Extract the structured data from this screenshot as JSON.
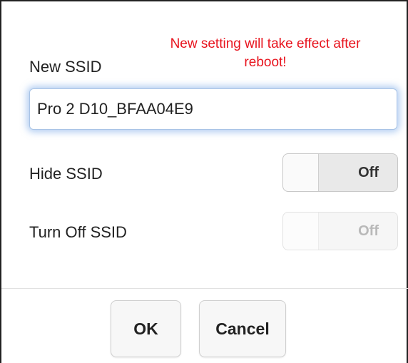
{
  "form": {
    "new_ssid_label": "New SSID",
    "warning_line1": "New setting will take effect after",
    "warning_line2": "reboot!",
    "ssid_value": "Pro 2 D10_BFAA04E9",
    "hide_ssid_label": "Hide SSID",
    "hide_ssid_state": "Off",
    "turn_off_ssid_label": "Turn Off SSID",
    "turn_off_ssid_state": "Off"
  },
  "buttons": {
    "ok_label": "OK",
    "cancel_label": "Cancel"
  },
  "colors": {
    "warning": "#e8141e",
    "input_focus_glow": "#6ea0e6"
  }
}
